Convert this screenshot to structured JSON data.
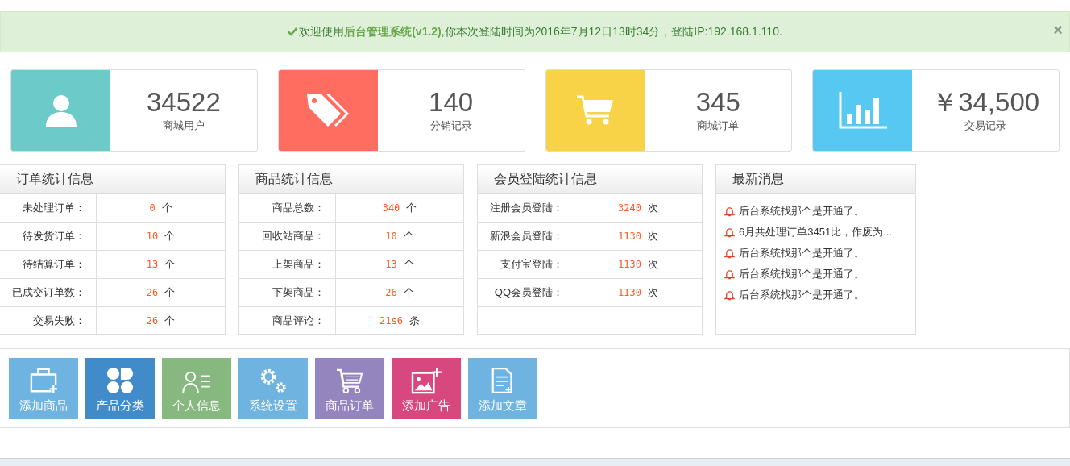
{
  "alert": {
    "text": "欢迎使用**后台管理系统(v1.2)**,你本次登陆时间为2016年7月12日13时34分，登陆IP:192.168.1.110.",
    "close": "×"
  },
  "stats": [
    {
      "kind": "user",
      "color": "#6ccac9",
      "value": "34522",
      "label": "商城用户"
    },
    {
      "kind": "tags",
      "color": "#ff6c60",
      "value": "140",
      "label": "分销记录"
    },
    {
      "kind": "cart",
      "color": "#f8d347",
      "value": "345",
      "label": "商城订单"
    },
    {
      "kind": "chart",
      "color": "#57c8f2",
      "value": "￥34,500",
      "label": "交易记录"
    }
  ],
  "panels": [
    {
      "title": "订单统计信息",
      "rows": [
        {
          "label": "未处理订单：",
          "value": "0",
          "unit": "个"
        },
        {
          "label": "待发货订单：",
          "value": "10",
          "unit": "个"
        },
        {
          "label": "待结算订单：",
          "value": "13",
          "unit": "个"
        },
        {
          "label": "已成交订单数：",
          "value": "26",
          "unit": "个"
        },
        {
          "label": "交易失败：",
          "value": "26",
          "unit": "个"
        }
      ]
    },
    {
      "title": "商品统计信息",
      "rows": [
        {
          "label": "商品总数：",
          "value": "340",
          "unit": "个"
        },
        {
          "label": "回收站商品：",
          "value": "10",
          "unit": "个"
        },
        {
          "label": "上架商品：",
          "value": "13",
          "unit": "个"
        },
        {
          "label": "下架商品：",
          "value": "26",
          "unit": "个"
        },
        {
          "label": "商品评论：",
          "value": "21s6",
          "unit": "条"
        }
      ]
    },
    {
      "title": "会员登陆统计信息",
      "rows": [
        {
          "label": "注册会员登陆：",
          "value": "3240",
          "unit": "次"
        },
        {
          "label": "新浪会员登陆：",
          "value": "1130",
          "unit": "次"
        },
        {
          "label": "支付宝登陆：",
          "value": "1130",
          "unit": "次"
        },
        {
          "label": "QQ会员登陆：",
          "value": "1130",
          "unit": "次"
        }
      ]
    }
  ],
  "news": {
    "title": "最新消息",
    "items": [
      "后台系统找那个是开通了。",
      "6月共处理订单3451比，作废为...",
      "后台系统找那个是开通了。",
      "后台系统找那个是开通了。",
      "后台系统找那个是开通了。"
    ]
  },
  "shortcuts": [
    {
      "kind": "bag",
      "color": "#6fb3e0",
      "label": "添加商品"
    },
    {
      "kind": "clover",
      "color": "#428bca",
      "label": "产品分类"
    },
    {
      "kind": "person",
      "color": "#87b87f",
      "label": "个人信息"
    },
    {
      "kind": "gears",
      "color": "#6fb3e0",
      "label": "系统设置"
    },
    {
      "kind": "cart",
      "color": "#9585bf",
      "label": "商品订单"
    },
    {
      "kind": "image",
      "color": "#d6487e",
      "label": "添加广告"
    },
    {
      "kind": "doc",
      "color": "#6fb3e0",
      "label": "添加文章"
    }
  ]
}
